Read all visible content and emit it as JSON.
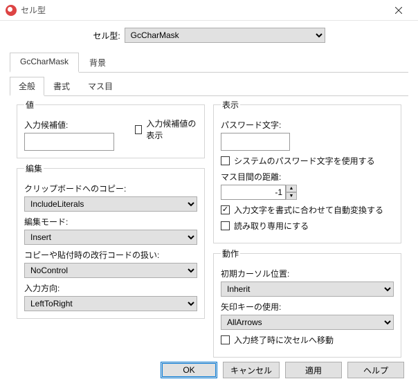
{
  "window": {
    "title": "セル型"
  },
  "topRow": {
    "label": "セル型:",
    "value": "GcCharMask"
  },
  "outerTabs": {
    "tab1": "GcCharMask",
    "tab2": "背景"
  },
  "innerTabs": {
    "tab1": "全般",
    "tab2": "書式",
    "tab3": "マス目"
  },
  "groups": {
    "value": {
      "legend": "値",
      "candidateLabel": "入力候補値:",
      "showCandidate": "入力候補値の表示"
    },
    "edit": {
      "legend": "編集",
      "clipboardLabel": "クリップボードへのコピー:",
      "clipboardValue": "IncludeLiterals",
      "editModeLabel": "編集モード:",
      "editModeValue": "Insert",
      "newlineLabel": "コピーや貼付時の改行コードの扱い:",
      "newlineValue": "NoControl",
      "directionLabel": "入力方向:",
      "directionValue": "LeftToRight"
    },
    "display": {
      "legend": "表示",
      "passwordLabel": "パスワード文字:",
      "useSystemPassword": "システムのパスワード文字を使用する",
      "distanceLabel": "マス目間の距離:",
      "distanceValue": "-1",
      "autoFormat": "入力文字を書式に合わせて自動変換する",
      "readonly": "読み取り専用にする"
    },
    "behavior": {
      "legend": "動作",
      "cursorLabel": "初期カーソル位置:",
      "cursorValue": "Inherit",
      "arrowLabel": "矢印キーの使用:",
      "arrowValue": "AllArrows",
      "moveNext": "入力終了時に次セルへ移動"
    }
  },
  "footer": {
    "ok": "OK",
    "cancel": "キャンセル",
    "apply": "適用",
    "help": "ヘルプ"
  }
}
